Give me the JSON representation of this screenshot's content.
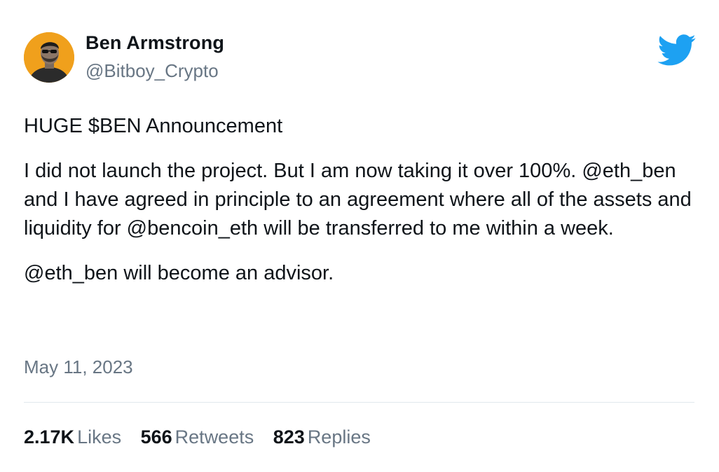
{
  "author": {
    "display_name": "Ben Armstrong",
    "handle": "@Bitboy_Crypto",
    "avatar_bg": "#f0a01c"
  },
  "brand": {
    "icon": "twitter-bird-icon",
    "color": "#1da1f2"
  },
  "tweet": {
    "paragraph_1": "HUGE $BEN Announcement",
    "paragraph_2": "I did not launch the project. But I am now taking it over 100%. @eth_ben and I have agreed in principle to an agreement where all of the assets and liquidity for @bencoin_eth will be transferred to me within a week.",
    "paragraph_3": "@eth_ben will become an advisor.",
    "date": "May 11, 2023"
  },
  "stats": {
    "likes": {
      "count": "2.17K",
      "label": "Likes"
    },
    "retweets": {
      "count": "566",
      "label": "Retweets"
    },
    "replies": {
      "count": "823",
      "label": "Replies"
    }
  }
}
